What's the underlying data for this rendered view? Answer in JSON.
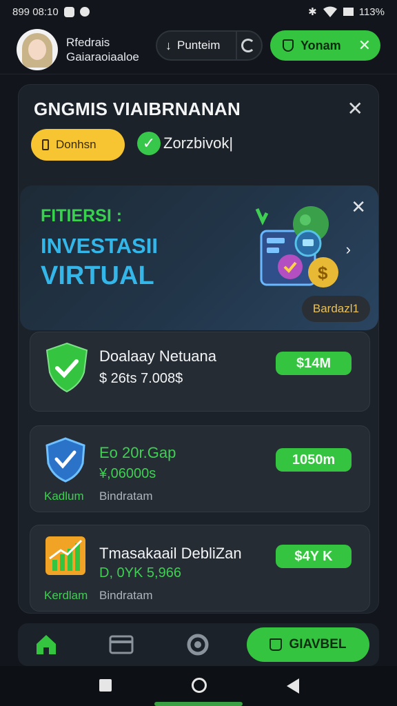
{
  "status_bar": {
    "time": "899 08:10",
    "battery": "113%"
  },
  "header": {
    "user_line1": "Rfedrais",
    "user_line2": "Gaiaraoiaaloe",
    "pill_label": "Punteim",
    "primary_label": "Yonam"
  },
  "card": {
    "title": "GNGMIS VIAIBRNANAN",
    "tag_label": "Donhsn",
    "check_label": "Zorzbivok|"
  },
  "promo": {
    "kicker": "FITIERSI :",
    "line1": "INVESTASII",
    "line2": "VIRTUAL",
    "badge": "Bardazl1"
  },
  "items": [
    {
      "title": "Doalaay Netuana",
      "subtitle": "$ 26ts 7.008$",
      "value": "$14M",
      "label_left": "",
      "label_right": ""
    },
    {
      "title": "Eo 20r.Gap",
      "subtitle": "¥,06000s",
      "value": "1050m",
      "label_left": "Kadlum",
      "label_right": "Bindratam"
    },
    {
      "title": "Tmasakaail DebliZan",
      "subtitle": "D, 0YK 5,966",
      "value": "$4Y K",
      "label_left": "Kerdlam",
      "label_right": "Bindratam"
    }
  ],
  "nav": {
    "cta_label": "GIAVBEL"
  },
  "colors": {
    "accent_green": "#35c43f",
    "accent_yellow": "#f7c531",
    "accent_blue": "#35b6e8",
    "background": "#12161c"
  }
}
